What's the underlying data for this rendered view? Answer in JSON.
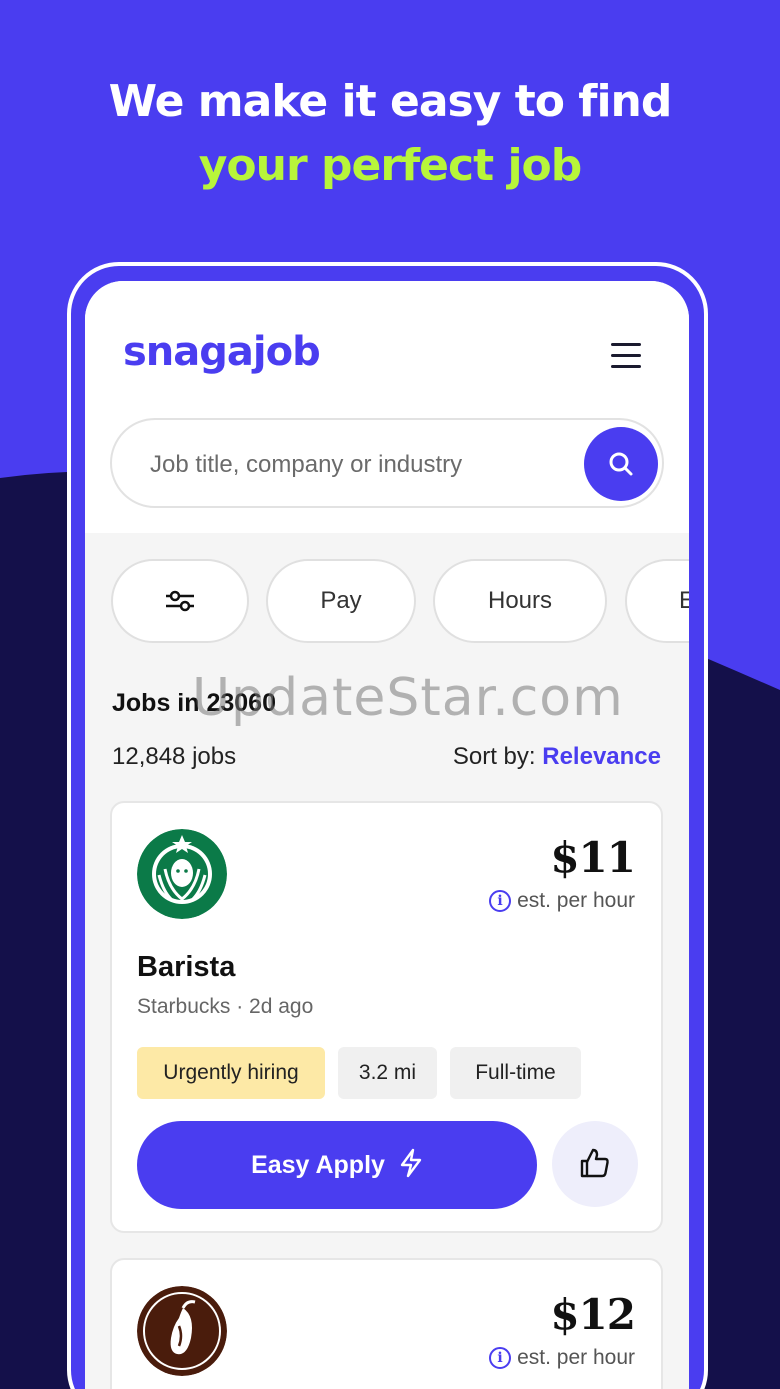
{
  "headline": {
    "line1": "We make it easy to find",
    "line2": "your perfect job"
  },
  "app": {
    "logo": "snagajob"
  },
  "search": {
    "placeholder": "Job title, company or industry"
  },
  "filters": {
    "pay": "Pay",
    "hours": "Hours",
    "more": "E"
  },
  "results": {
    "heading": "Jobs in 23060",
    "count": "12,848 jobs",
    "sort_label": "Sort by:",
    "sort_value": "Relevance"
  },
  "jobs": [
    {
      "pay": "$11",
      "pay_note": "est. per hour",
      "title": "Barista",
      "company": "Starbucks",
      "posted": "2d ago",
      "tags": [
        "Urgently hiring",
        "3.2 mi",
        "Full-time"
      ],
      "apply_label": "Easy Apply"
    },
    {
      "pay": "$12",
      "pay_note": "est. per hour"
    }
  ],
  "watermark": "UpdateStar.com",
  "colors": {
    "brand": "#4a3df0",
    "accent": "#b8f53a",
    "dark_bg": "#14104a",
    "urgent_tag": "#fde9a6"
  }
}
